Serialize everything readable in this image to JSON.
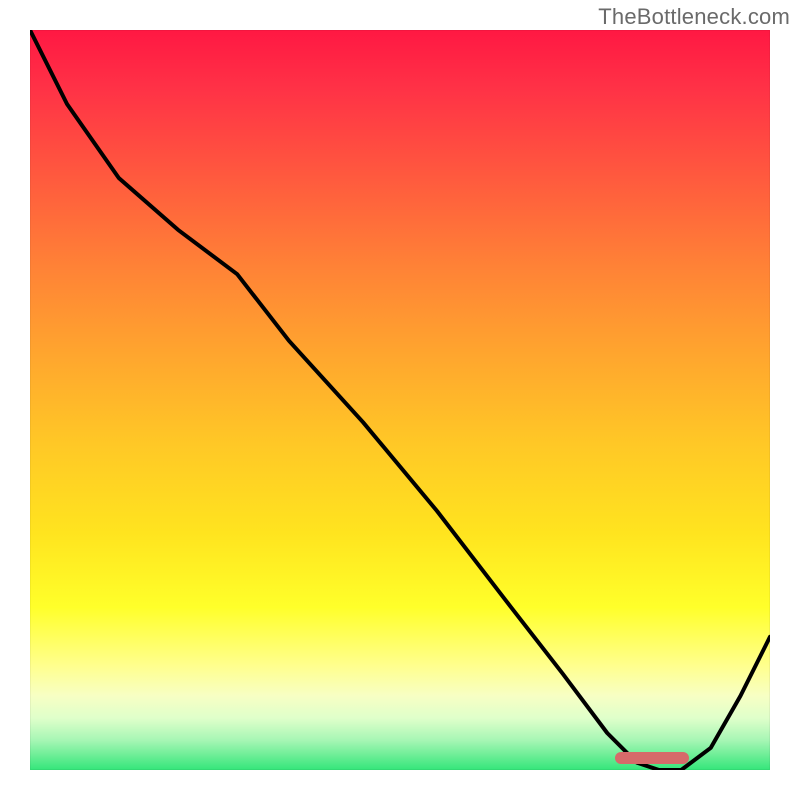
{
  "watermark": "TheBottleneck.com",
  "colors": {
    "gradient_top": "#ff1843",
    "gradient_mid": "#ffe41f",
    "gradient_bottom": "#34e67a",
    "line": "#000000",
    "marker": "#d66a6a",
    "watermark_text": "#6a6a6a"
  },
  "chart_data": {
    "type": "line",
    "title": "",
    "xlabel": "",
    "ylabel": "",
    "xlim": [
      0,
      100
    ],
    "ylim": [
      0,
      100
    ],
    "grid": false,
    "legend": false,
    "series": [
      {
        "name": "curve",
        "x": [
          0,
          5,
          12,
          20,
          28,
          35,
          45,
          55,
          65,
          72,
          78,
          82,
          85,
          88,
          92,
          96,
          100
        ],
        "values": [
          100,
          90,
          80,
          73,
          67,
          58,
          47,
          35,
          22,
          13,
          5,
          1,
          0,
          0,
          3,
          10,
          18
        ]
      }
    ],
    "marker": {
      "x_start": 79,
      "x_end": 89,
      "y": 0.8
    },
    "annotations": []
  }
}
